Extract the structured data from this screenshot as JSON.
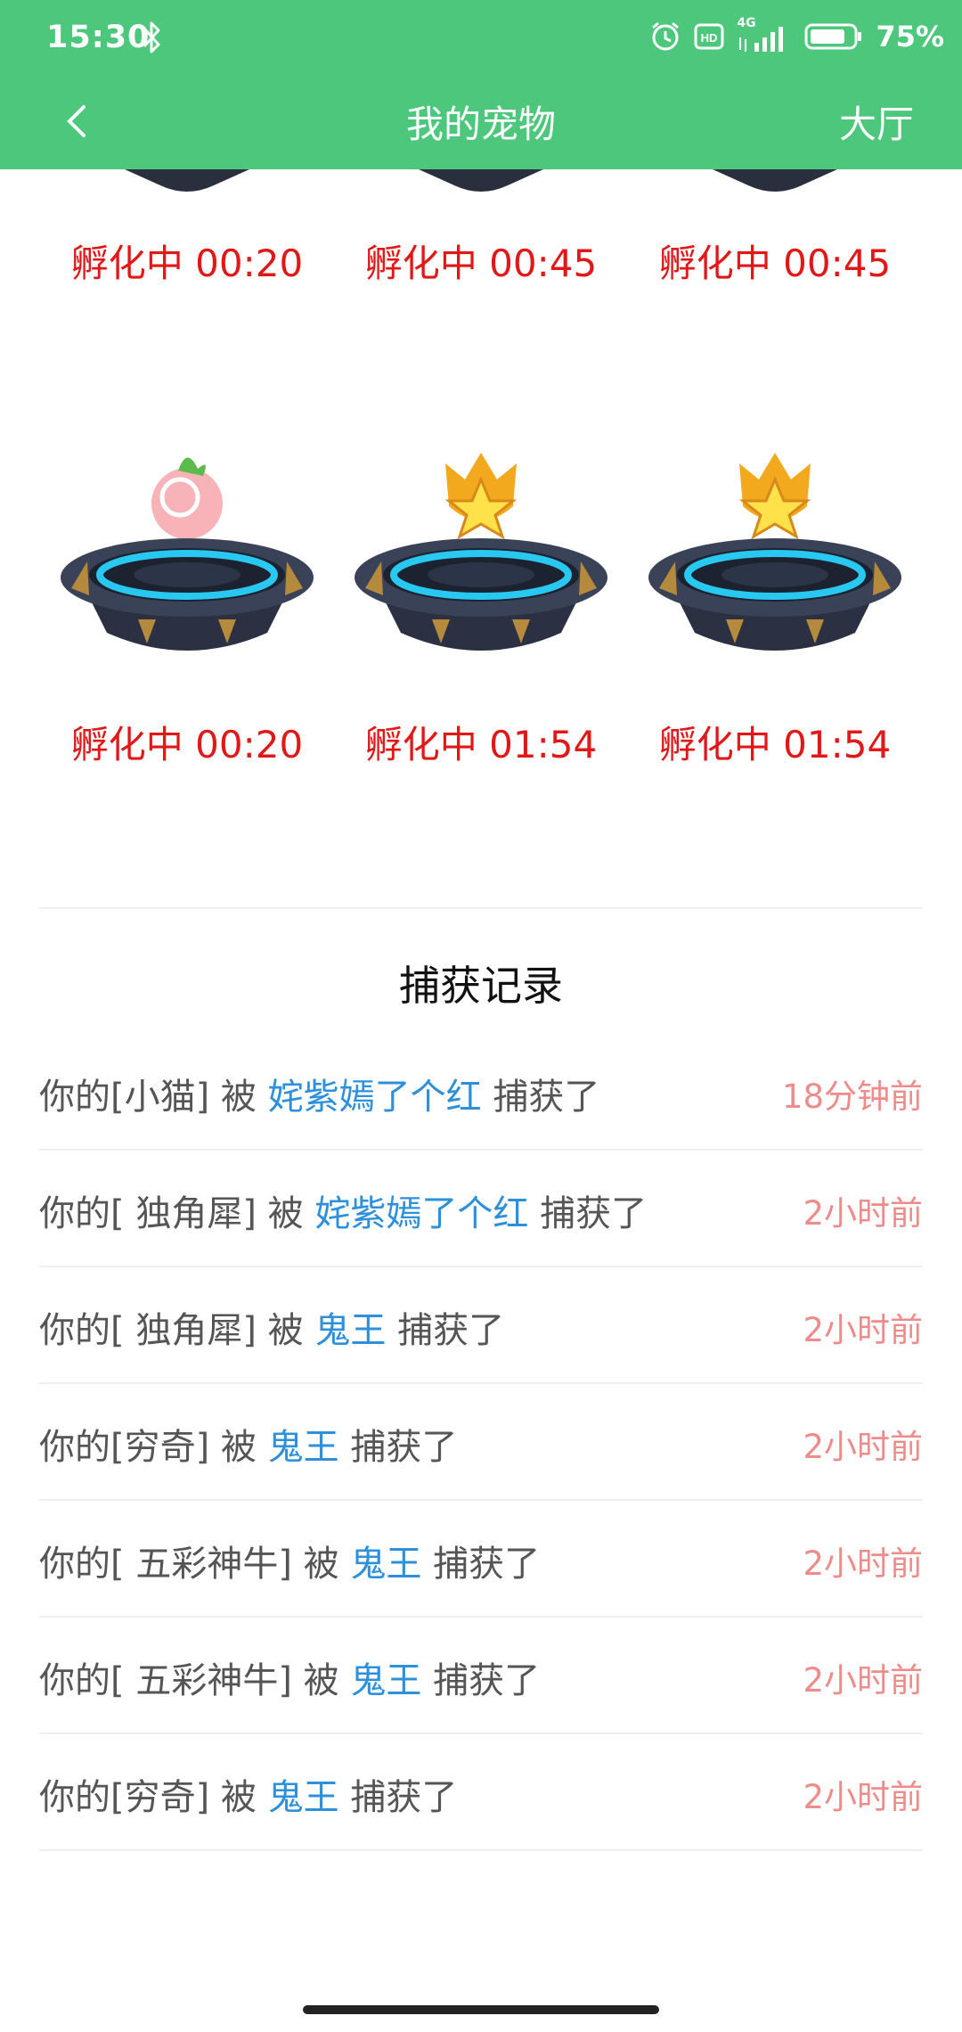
{
  "status_bar": {
    "time": "15:30",
    "network": "4G",
    "battery": "75%"
  },
  "navbar": {
    "title": "我的宠物",
    "right_label": "大厅"
  },
  "pets_top_row": [
    {
      "status": "孵化中 00:20"
    },
    {
      "status": "孵化中 00:45"
    },
    {
      "status": "孵化中 00:45"
    }
  ],
  "pets_row": [
    {
      "egg": "peach-egg-icon",
      "status": "孵化中 00:20"
    },
    {
      "egg": "star-egg-icon",
      "status": "孵化中 01:54"
    },
    {
      "egg": "star-egg-icon",
      "status": "孵化中 01:54"
    }
  ],
  "records": {
    "title": "捕获记录",
    "items": [
      {
        "prefix": "你的[小猫] 被 ",
        "who": "姹紫嫣了个红",
        "suffix": " 捕获了",
        "ago": "18分钟前"
      },
      {
        "prefix": "你的[ 独角犀] 被 ",
        "who": "姹紫嫣了个红",
        "suffix": " 捕获了",
        "ago": "2小时前"
      },
      {
        "prefix": "你的[ 独角犀] 被 ",
        "who": "鬼王",
        "suffix": " 捕获了",
        "ago": "2小时前"
      },
      {
        "prefix": "你的[穷奇] 被 ",
        "who": "鬼王",
        "suffix": " 捕获了",
        "ago": "2小时前"
      },
      {
        "prefix": "你的[ 五彩神牛] 被 ",
        "who": "鬼王",
        "suffix": " 捕获了",
        "ago": "2小时前"
      },
      {
        "prefix": "你的[ 五彩神牛] 被 ",
        "who": "鬼王",
        "suffix": " 捕获了",
        "ago": "2小时前"
      },
      {
        "prefix": "你的[穷奇] 被 ",
        "who": "鬼王",
        "suffix": " 捕获了",
        "ago": "2小时前"
      }
    ]
  },
  "colors": {
    "header": "#4CC77B",
    "hatch_text": "#E01818",
    "player_name": "#2E8FDB",
    "time_ago": "#EE8C8C"
  }
}
